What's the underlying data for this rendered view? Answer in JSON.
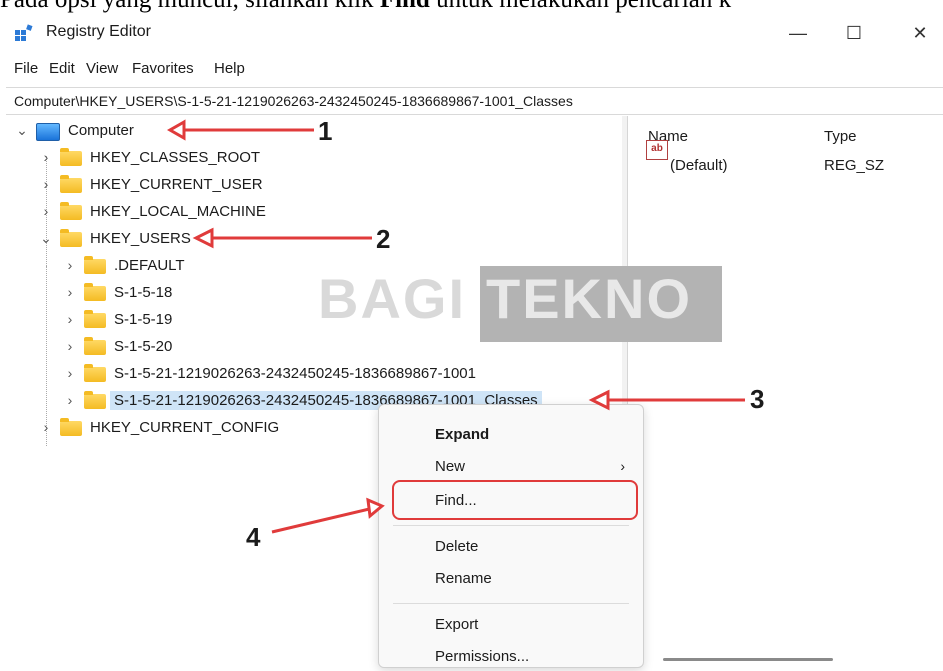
{
  "caption": {
    "prefix": "Pada opsi yang muncul, silahkan klik ",
    "bold": "Find",
    "suffix": " untuk melakukan pencarian k"
  },
  "window": {
    "title": "Registry Editor",
    "minimize": "—",
    "maximize": "☐",
    "close": "✕"
  },
  "menu": {
    "items": [
      "File",
      "Edit",
      "View",
      "Favorites",
      "Help"
    ]
  },
  "address": {
    "path": "Computer\\HKEY_USERS\\S-1-5-21-1219026263-2432450245-1836689867-1001_Classes"
  },
  "tree": {
    "root": "Computer",
    "hives": [
      "HKEY_CLASSES_ROOT",
      "HKEY_CURRENT_USER",
      "HKEY_LOCAL_MACHINE",
      "HKEY_USERS",
      "HKEY_CURRENT_CONFIG"
    ],
    "users_children": [
      ".DEFAULT",
      "S-1-5-18",
      "S-1-5-19",
      "S-1-5-20",
      "S-1-5-21-1219026263-2432450245-1836689867-1001",
      "S-1-5-21-1219026263-2432450245-1836689867-1001_Classes"
    ]
  },
  "values_pane": {
    "col_name": "Name",
    "col_type": "Type",
    "row_name": "(Default)",
    "row_type": "REG_SZ",
    "icon_text": "ab"
  },
  "context_menu": {
    "expand": "Expand",
    "new": "New",
    "find": "Find...",
    "delete": "Delete",
    "rename": "Rename",
    "export": "Export",
    "permissions": "Permissions..."
  },
  "annotations": [
    "1",
    "2",
    "3",
    "4"
  ],
  "watermark": {
    "left": "BAGI",
    "right": "TEKNO"
  },
  "colors": {
    "annotation_red": "#e03b3b",
    "selection": "#cfe4f7",
    "folder": "#f4bb23"
  }
}
